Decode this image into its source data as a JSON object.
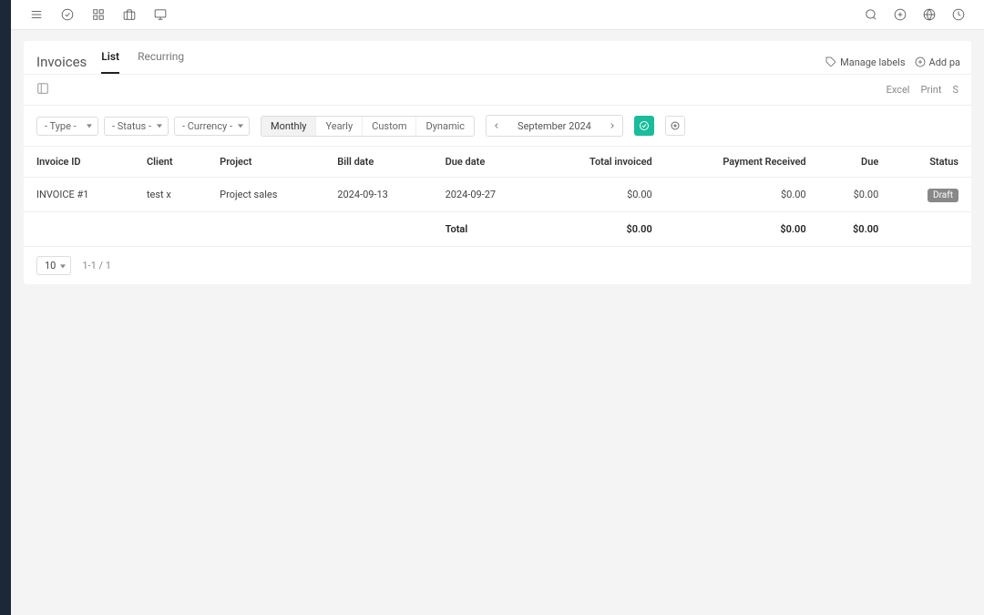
{
  "page": {
    "title": "Invoices",
    "tabs": [
      {
        "label": "List",
        "active": true
      },
      {
        "label": "Recurring",
        "active": false
      }
    ]
  },
  "headerActions": {
    "manageLabels": "Manage labels",
    "addPayment": "Add pa"
  },
  "export": {
    "excel": "Excel",
    "print": "Print",
    "s": "S"
  },
  "filters": {
    "type": "- Type -",
    "status": "- Status -",
    "currency": "- Currency -"
  },
  "periods": {
    "monthly": "Monthly",
    "yearly": "Yearly",
    "custom": "Custom",
    "dynamic": "Dynamic"
  },
  "dateNav": {
    "label": "September 2024"
  },
  "columns": {
    "invoiceId": "Invoice ID",
    "client": "Client",
    "project": "Project",
    "billDate": "Bill date",
    "dueDate": "Due date",
    "totalInvoiced": "Total invoiced",
    "paymentReceived": "Payment Received",
    "due": "Due",
    "status": "Status"
  },
  "rows": [
    {
      "invoiceId": "INVOICE #1",
      "client": "test x",
      "project": "Project sales",
      "billDate": "2024-09-13",
      "dueDate": "2024-09-27",
      "totalInvoiced": "$0.00",
      "paymentReceived": "$0.00",
      "due": "$0.00",
      "status": "Draft"
    }
  ],
  "totals": {
    "label": "Total",
    "totalInvoiced": "$0.00",
    "paymentReceived": "$0.00",
    "due": "$0.00"
  },
  "pagination": {
    "pageSize": "10",
    "info": "1-1 / 1"
  }
}
